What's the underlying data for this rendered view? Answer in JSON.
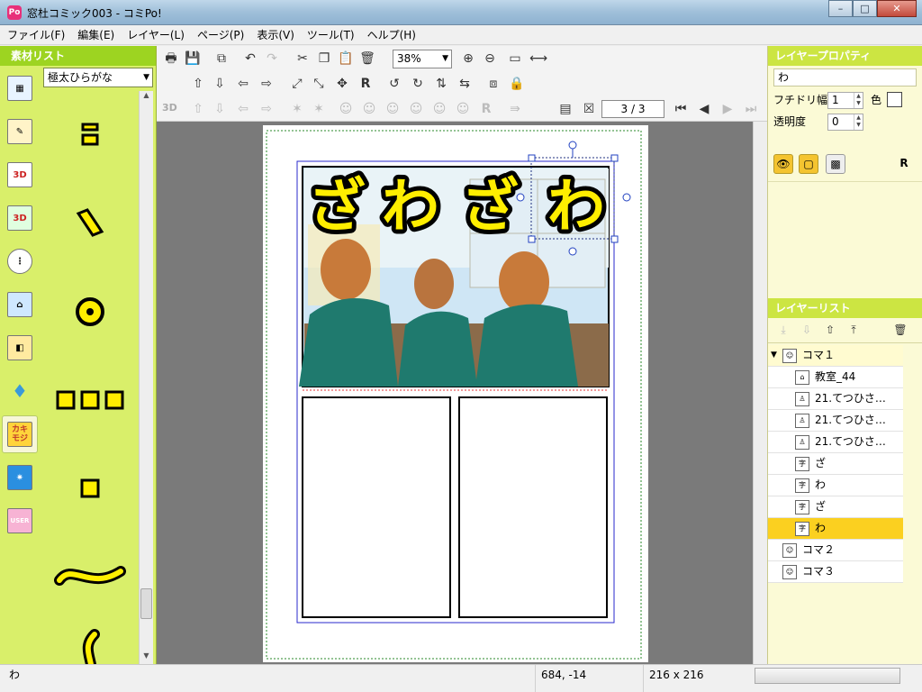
{
  "window": {
    "title": "窓杜コミック003 - コミPo!",
    "app_icon": "comipo-app-icon",
    "minimize": "–",
    "maximize": "□",
    "close": "✕"
  },
  "menu": [
    "ファイル(F)",
    "編集(E)",
    "レイヤー(L)",
    "ページ(P)",
    "表示(V)",
    "ツール(T)",
    "ヘルプ(H)"
  ],
  "material_panel": {
    "title": "素材リスト",
    "font_select": "極太ひらがな",
    "categories": [
      {
        "name": "frame-layout-icon",
        "glyph": "▦"
      },
      {
        "name": "background-image-icon",
        "glyph": "🖼"
      },
      {
        "name": "character-3d-icon",
        "glyph": "3D"
      },
      {
        "name": "object-3d-icon",
        "glyph": "3D"
      },
      {
        "name": "speech-balloon-icon",
        "glyph": "…"
      },
      {
        "name": "background-scene-icon",
        "glyph": "🏫"
      },
      {
        "name": "image-cube-icon",
        "glyph": "▣"
      },
      {
        "name": "effect-drop-icon",
        "glyph": "💧"
      },
      {
        "name": "handwriting-text-icon",
        "glyph": "カキ モジ"
      },
      {
        "name": "effect-burst-icon",
        "glyph": "✷"
      },
      {
        "name": "user-material-icon",
        "glyph": "USER"
      }
    ],
    "glyphs": [
      "ロ",
      "ヽ",
      "◉",
      "□□□",
      "▫",
      "〜",
      "ϛ"
    ]
  },
  "toolbar": {
    "zoom": "38%",
    "page_indicator": "3 / 3",
    "label_3d": "3D"
  },
  "canvas": {
    "sfx_text": [
      "ざ",
      "わ",
      "ざ",
      "わ"
    ],
    "sfx_fill": "#ffee00",
    "sfx_stroke": "#000000"
  },
  "layer_property": {
    "title": "レイヤープロパティ",
    "text_value": "わ",
    "outline_label": "フチドリ幅",
    "outline_value": "1",
    "color_label": "色",
    "opacity_label": "透明度",
    "opacity_value": "0"
  },
  "layer_list": {
    "title": "レイヤーリスト",
    "rows": [
      {
        "name": "panel-1",
        "label": "コマ１",
        "indent": 0,
        "type": "group",
        "selected": false,
        "expanded": true
      },
      {
        "name": "layer-classroom",
        "label": "教室_44",
        "indent": 1,
        "type": "bg",
        "selected": false
      },
      {
        "name": "layer-char-1",
        "label": "21.てつひさ…",
        "indent": 1,
        "type": "char",
        "selected": false
      },
      {
        "name": "layer-char-2",
        "label": "21.てつひさ…",
        "indent": 1,
        "type": "char",
        "selected": false
      },
      {
        "name": "layer-char-3",
        "label": "21.てつひさ…",
        "indent": 1,
        "type": "char",
        "selected": false
      },
      {
        "name": "layer-text-za-1",
        "label": "ざ",
        "indent": 1,
        "type": "text",
        "selected": false
      },
      {
        "name": "layer-text-wa-1",
        "label": "わ",
        "indent": 1,
        "type": "text",
        "selected": false
      },
      {
        "name": "layer-text-za-2",
        "label": "ざ",
        "indent": 1,
        "type": "text",
        "selected": false
      },
      {
        "name": "layer-text-wa-2",
        "label": "わ",
        "indent": 1,
        "type": "text",
        "selected": true
      },
      {
        "name": "panel-2",
        "label": "コマ２",
        "indent": 0,
        "type": "group",
        "selected": false
      },
      {
        "name": "panel-3",
        "label": "コマ３",
        "indent": 0,
        "type": "group",
        "selected": false
      }
    ]
  },
  "status": {
    "text": "わ",
    "coords": "684, -14",
    "size": "216 x 216"
  }
}
